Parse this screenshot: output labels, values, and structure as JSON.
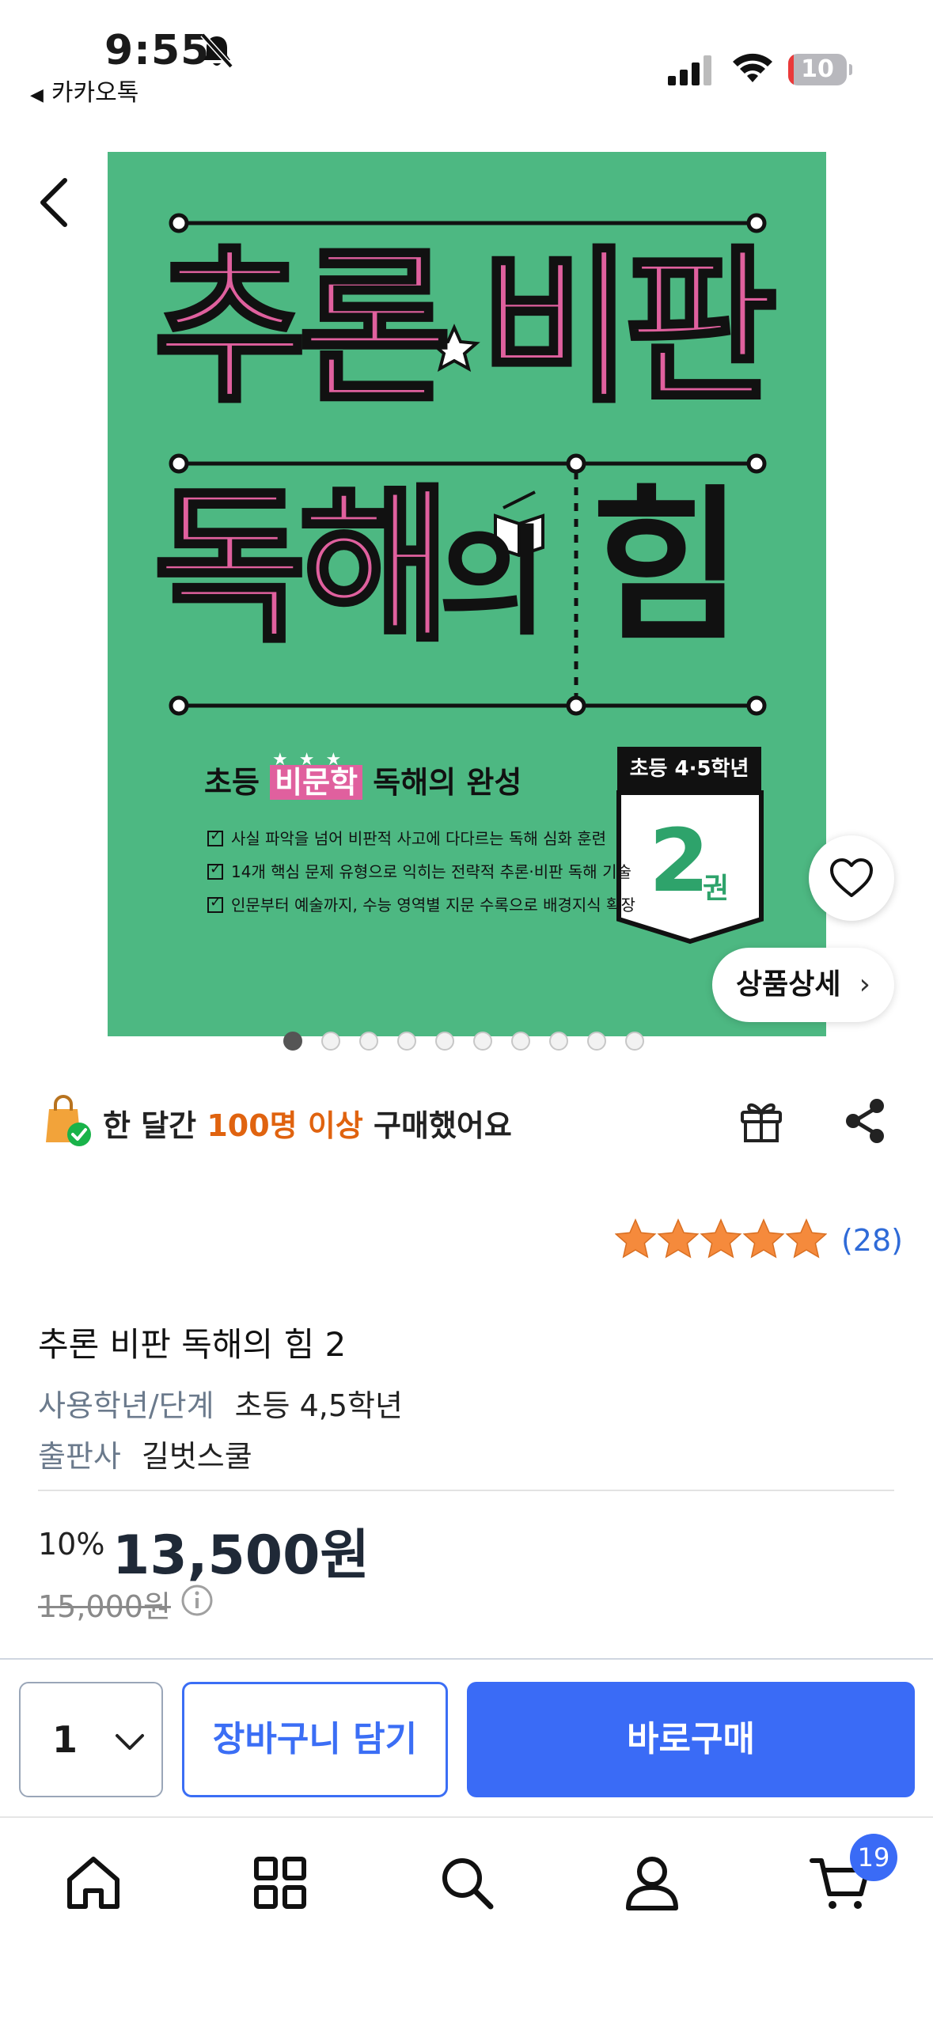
{
  "status_bar": {
    "time": "9:55",
    "back_app": "카카오톡",
    "battery": "10",
    "battery_level": 0.1
  },
  "cover": {
    "title_line1_a": "추론",
    "title_line1_b": "비판",
    "title_line2_a": "독해",
    "title_line2_b": "의",
    "title_line2_c": "힘",
    "subtitle_pre": "초등",
    "subtitle_hl": "비문학",
    "subtitle_post": "독해의 완성",
    "bullets": [
      "사실 파악을 넘어 비판적 사고에 다다르는 독해 심화 훈련",
      "14개 핵심 문제 유형으로 익히는 전략적 추론·비판 독해 기술",
      "인문부터 예술까지, 수능 영역별 지문 수록으로 배경지식 확장"
    ],
    "badge_grade": "초등 4·5학년",
    "badge_number": "2",
    "badge_unit": "권"
  },
  "image_controls": {
    "detail_label": "상품상세",
    "page_count": 10,
    "current_page": 1
  },
  "social_proof": {
    "prefix": "한 달간",
    "highlight": "100명 이상",
    "suffix": "구매했어요"
  },
  "rating": {
    "stars": 5,
    "count_label": "(28)"
  },
  "product": {
    "title": "추론 비판 독해의 힘 2",
    "specs": [
      {
        "key": "사용학년/단계",
        "value": "초등 4,5학년"
      },
      {
        "key": "출판사",
        "value": "길벗스쿨"
      }
    ],
    "discount": "10%",
    "price": "13,500원",
    "original_price": "15,000원"
  },
  "purchase_bar": {
    "quantity": "1",
    "cart_label": "장바구니 담기",
    "buy_label": "바로구매"
  },
  "tab_bar": {
    "items": [
      "home-icon",
      "category-icon",
      "search-icon",
      "my-page-icon",
      "cart-icon"
    ],
    "cart_badge": "19"
  },
  "colors": {
    "accent": "#3a6bf6",
    "cover_bg": "#4db882",
    "cover_pink": "#e0609e",
    "highlight_orange": "#e0630f",
    "star": "#f58a3c"
  }
}
